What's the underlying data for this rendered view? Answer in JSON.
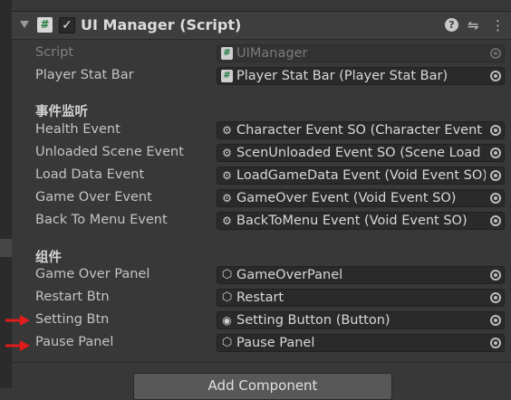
{
  "header": {
    "title": "UI Manager (Script)",
    "script_icon": "#",
    "checkbox": "✓",
    "help_icon": "?",
    "presets_icon": "⇋",
    "menu_icon": "⋮"
  },
  "rows": {
    "script": {
      "label": "Script",
      "value": "UIManager"
    },
    "player_stat_bar": {
      "label": "Player Stat Bar",
      "value": "Player Stat Bar (Player Stat Bar)"
    }
  },
  "section1": {
    "title": "事件监听",
    "rows": [
      {
        "label": "Health Event",
        "value": "Character Event SO (Character Event SO)"
      },
      {
        "label": "Unloaded Scene Event",
        "value": "ScenUnloaded Event SO (Scene Load Event SO)"
      },
      {
        "label": "Load Data Event",
        "value": "LoadGameData Event (Void Event SO)"
      },
      {
        "label": "Game Over Event",
        "value": "GameOver Event (Void Event SO)"
      },
      {
        "label": "Back To Menu Event",
        "value": "BackToMenu Event (Void Event SO)"
      }
    ]
  },
  "section2": {
    "title": "组件",
    "rows": [
      {
        "label": "Game Over Panel",
        "value": "GameOverPanel"
      },
      {
        "label": "Restart Btn",
        "value": "Restart"
      },
      {
        "label": "Setting Btn",
        "value": "Setting Button (Button)"
      },
      {
        "label": "Pause Panel",
        "value": "Pause Panel"
      }
    ]
  },
  "add_component_label": "Add Component",
  "colors": {
    "background": "#383838",
    "field": "#2a2a2a",
    "annotation_arrow": "#e01c1c"
  }
}
